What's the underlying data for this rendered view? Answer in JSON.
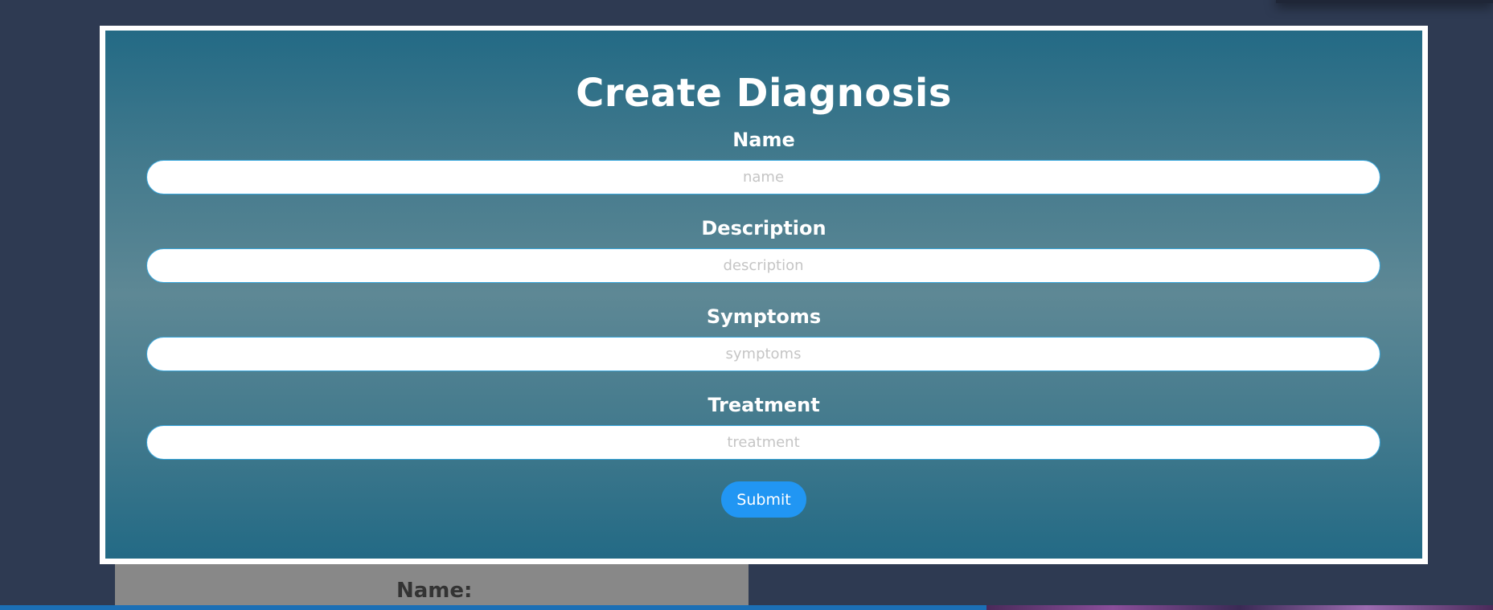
{
  "form": {
    "title": "Create Diagnosis",
    "fields": [
      {
        "label": "Name",
        "placeholder": "name"
      },
      {
        "label": "Description",
        "placeholder": "description"
      },
      {
        "label": "Symptoms",
        "placeholder": "symptoms"
      },
      {
        "label": "Treatment",
        "placeholder": "treatment"
      }
    ],
    "submit_label": "Submit"
  },
  "background": {
    "under_label": "Name:"
  },
  "colors": {
    "page_bg": "#2e3a52",
    "modal_top": "#236a85",
    "modal_mid": "#5e8895",
    "accent": "#2196f3",
    "input_border": "#3aa7dc"
  }
}
